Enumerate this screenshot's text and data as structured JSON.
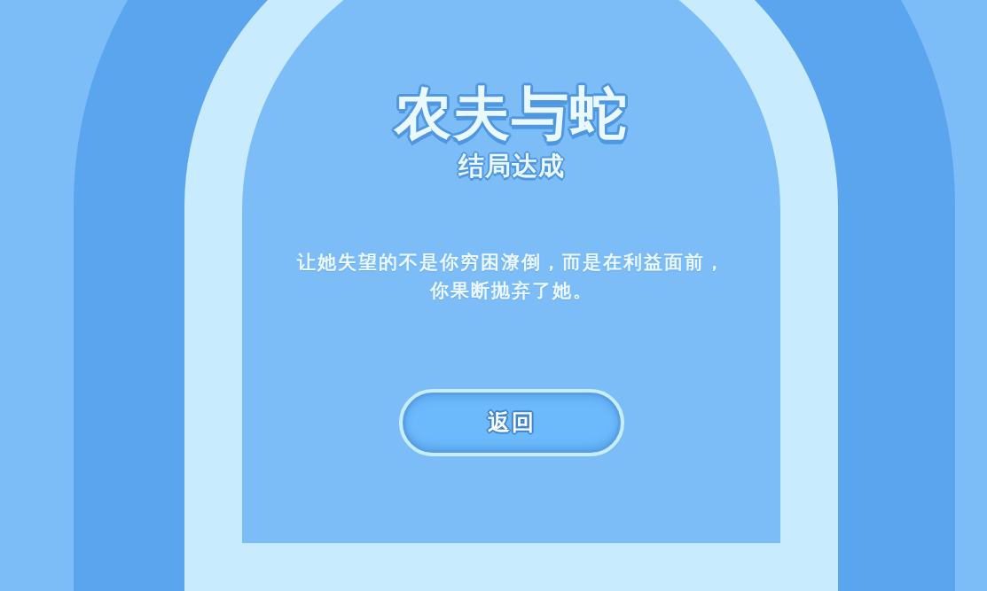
{
  "ending_screen": {
    "title": "农夫与蛇",
    "subtitle": "结局达成",
    "message": "让她失望的不是你穷困潦倒，而是在利益面前，你果断抛弃了她。",
    "back_button": {
      "label": "返回"
    }
  }
}
